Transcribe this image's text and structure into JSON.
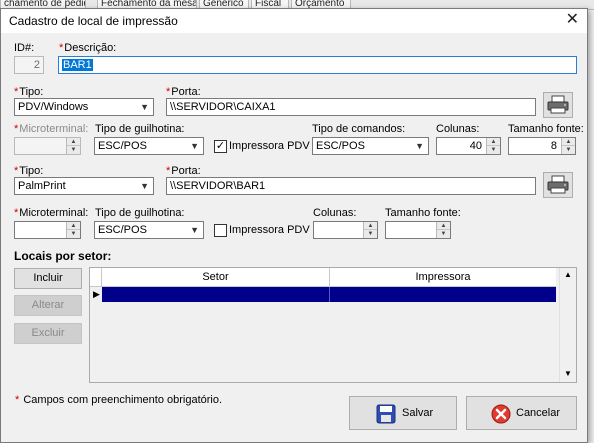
{
  "background": {
    "tabs": [
      "chamento de pedido",
      "Fechamento da mesa",
      "Genérico",
      "Fiscal",
      "Orçamento"
    ]
  },
  "dialog": {
    "title": "Cadastro de local de impressão",
    "id_label": "ID#:",
    "id_value": "2",
    "descricao_label": "Descrição:",
    "descricao_value": "BAR1",
    "required_marker": "*"
  },
  "printer1": {
    "tipo_label": "Tipo:",
    "tipo_value": "PDV/Windows",
    "porta_label": "Porta:",
    "porta_value": "\\\\SERVIDOR\\CAIXA1",
    "microterminal_label": "Microterminal:",
    "guilhotina_label": "Tipo de guilhotina:",
    "guilhotina_value": "ESC/POS",
    "impressora_pdv_label": "Impressora PDV",
    "impressora_pdv_checked": "✓",
    "comandos_label": "Tipo de comandos:",
    "comandos_value": "ESC/POS",
    "colunas_label": "Colunas:",
    "colunas_value": "40",
    "fonte_label": "Tamanho fonte:",
    "fonte_value": "8"
  },
  "printer2": {
    "tipo_label": "Tipo:",
    "tipo_value": "PalmPrint",
    "porta_label": "Porta:",
    "porta_value": "\\\\SERVIDOR\\BAR1",
    "microterminal_label": "Microterminal:",
    "guilhotina_label": "Tipo de guilhotina:",
    "guilhotina_value": "ESC/POS",
    "impressora_pdv_label": "Impressora PDV",
    "colunas_label": "Colunas:",
    "fonte_label": "Tamanho fonte:"
  },
  "sector": {
    "heading": "Locais por setor:",
    "incluir": "Incluir",
    "alterar": "Alterar",
    "excluir": "Excluir",
    "columns": [
      "Setor",
      "Impressora"
    ]
  },
  "footer": {
    "hint": "Campos com preenchimento obrigatório.",
    "salvar": "Salvar",
    "cancelar": "Cancelar"
  }
}
